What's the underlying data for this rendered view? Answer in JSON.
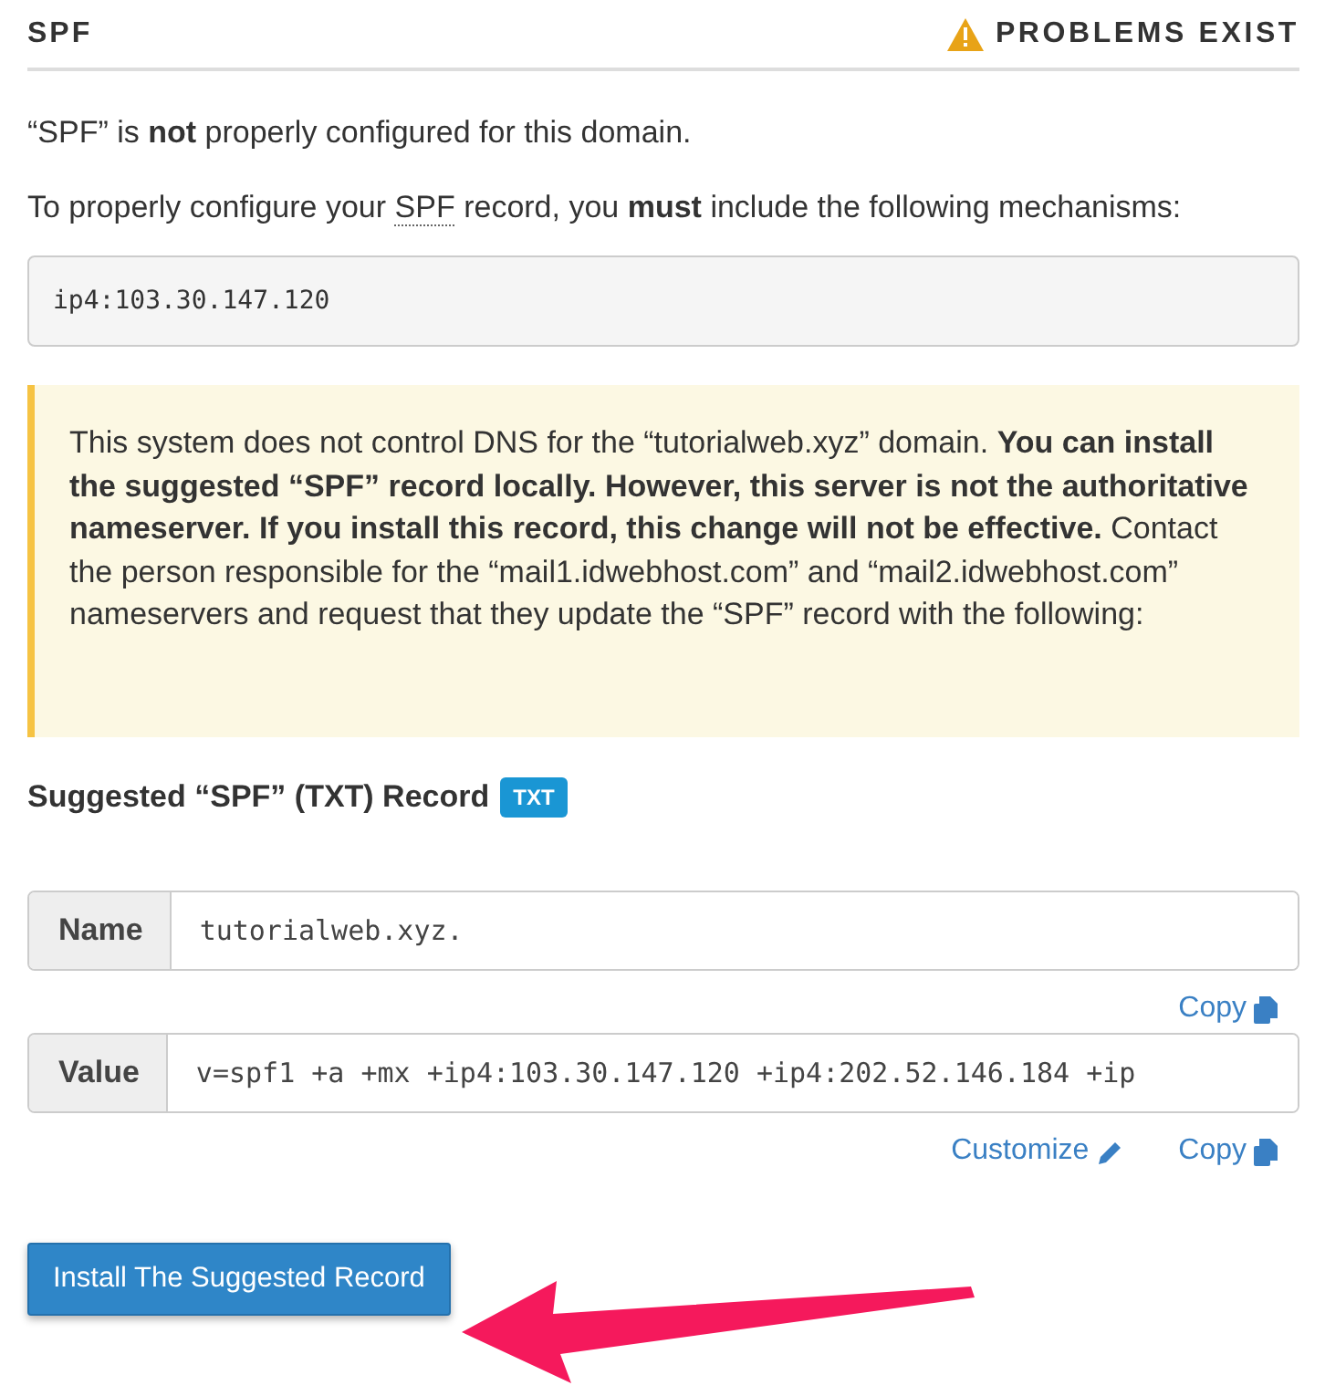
{
  "header": {
    "title": "SPF",
    "status": "PROBLEMS EXIST"
  },
  "intro": "“SPF” is **not** properly configured for this domain.",
  "instruction": {
    "before": "To properly configure your",
    "abbr": "SPF",
    "after": "record, you **must** include the following mechanisms:"
  },
  "mechanisms": "ip4:103.30.147.120",
  "notice": "This system does not control DNS for the “tutorialweb.xyz” domain. **You can install the suggested “SPF” record locally. However, this server is not the authoritative nameserver. If you install this record, this change will not be effective.** Contact the person responsible for the “mail1.idwebhost.com” and “mail2.idwebhost.com” nameservers and request that they update the “SPF” record with the following:",
  "suggested": {
    "title": "Suggested “SPF” (TXT) Record",
    "badge": "TXT"
  },
  "fields": [
    {
      "label": "Name",
      "value": "tutorialweb.xyz.",
      "actions": [
        "Copy"
      ]
    },
    {
      "label": "Value",
      "value": "v=spf1 +a +mx +ip4:103.30.147.120 +ip4:202.52.146.184 +ip",
      "actions": [
        "Customize",
        "Copy"
      ]
    }
  ],
  "install_button": "Install The Suggested Record"
}
